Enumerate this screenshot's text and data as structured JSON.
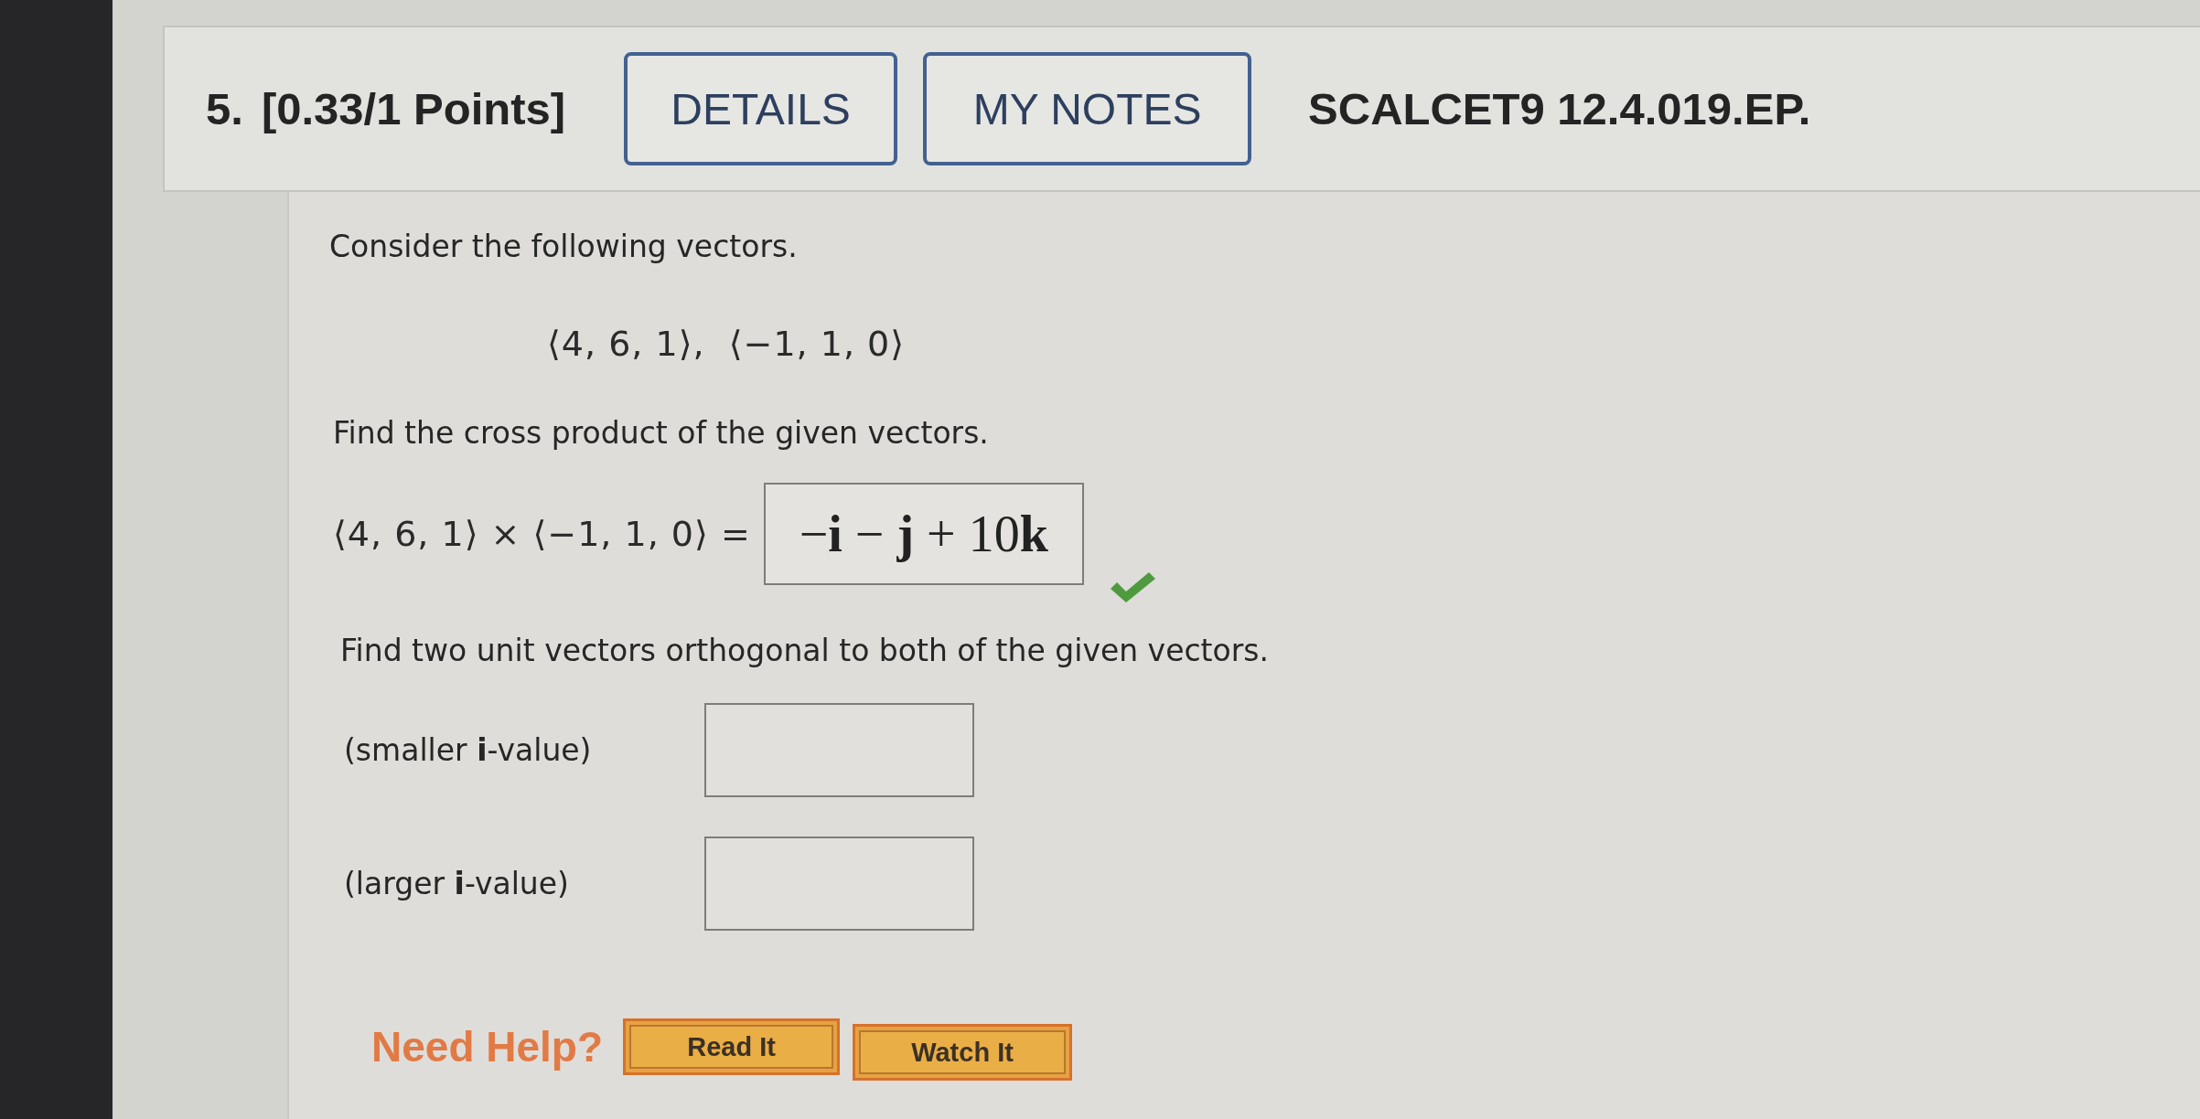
{
  "header": {
    "number": "5.",
    "points": "[0.33/1 Points]",
    "buttons": [
      {
        "label": "DETAILS"
      },
      {
        "label": "MY NOTES"
      }
    ],
    "code": "SCALCET9 12.4.019.EP."
  },
  "question": {
    "intro": "Consider the following vectors.",
    "vectors": "⟨4, 6, 1⟩,  ⟨−1, 1, 0⟩",
    "cross_prompt": "Find the cross product of the given vectors.",
    "cross_equation": {
      "expression": "⟨4, 6, 1⟩ × ⟨−1, 1, 0⟩ =",
      "value": "−**i** − **j** + 10**k**",
      "correct": true
    },
    "unit_prompt": "Find two unit vectors orthogonal to both of the given vectors.",
    "unit_answers": [
      {
        "label": "(smaller **i**-value)"
      },
      {
        "label": "(larger **i**-value)"
      }
    ]
  },
  "help": {
    "label": "Need Help?",
    "buttons": [
      {
        "label": "Read It"
      },
      {
        "label": "Watch It"
      }
    ]
  }
}
